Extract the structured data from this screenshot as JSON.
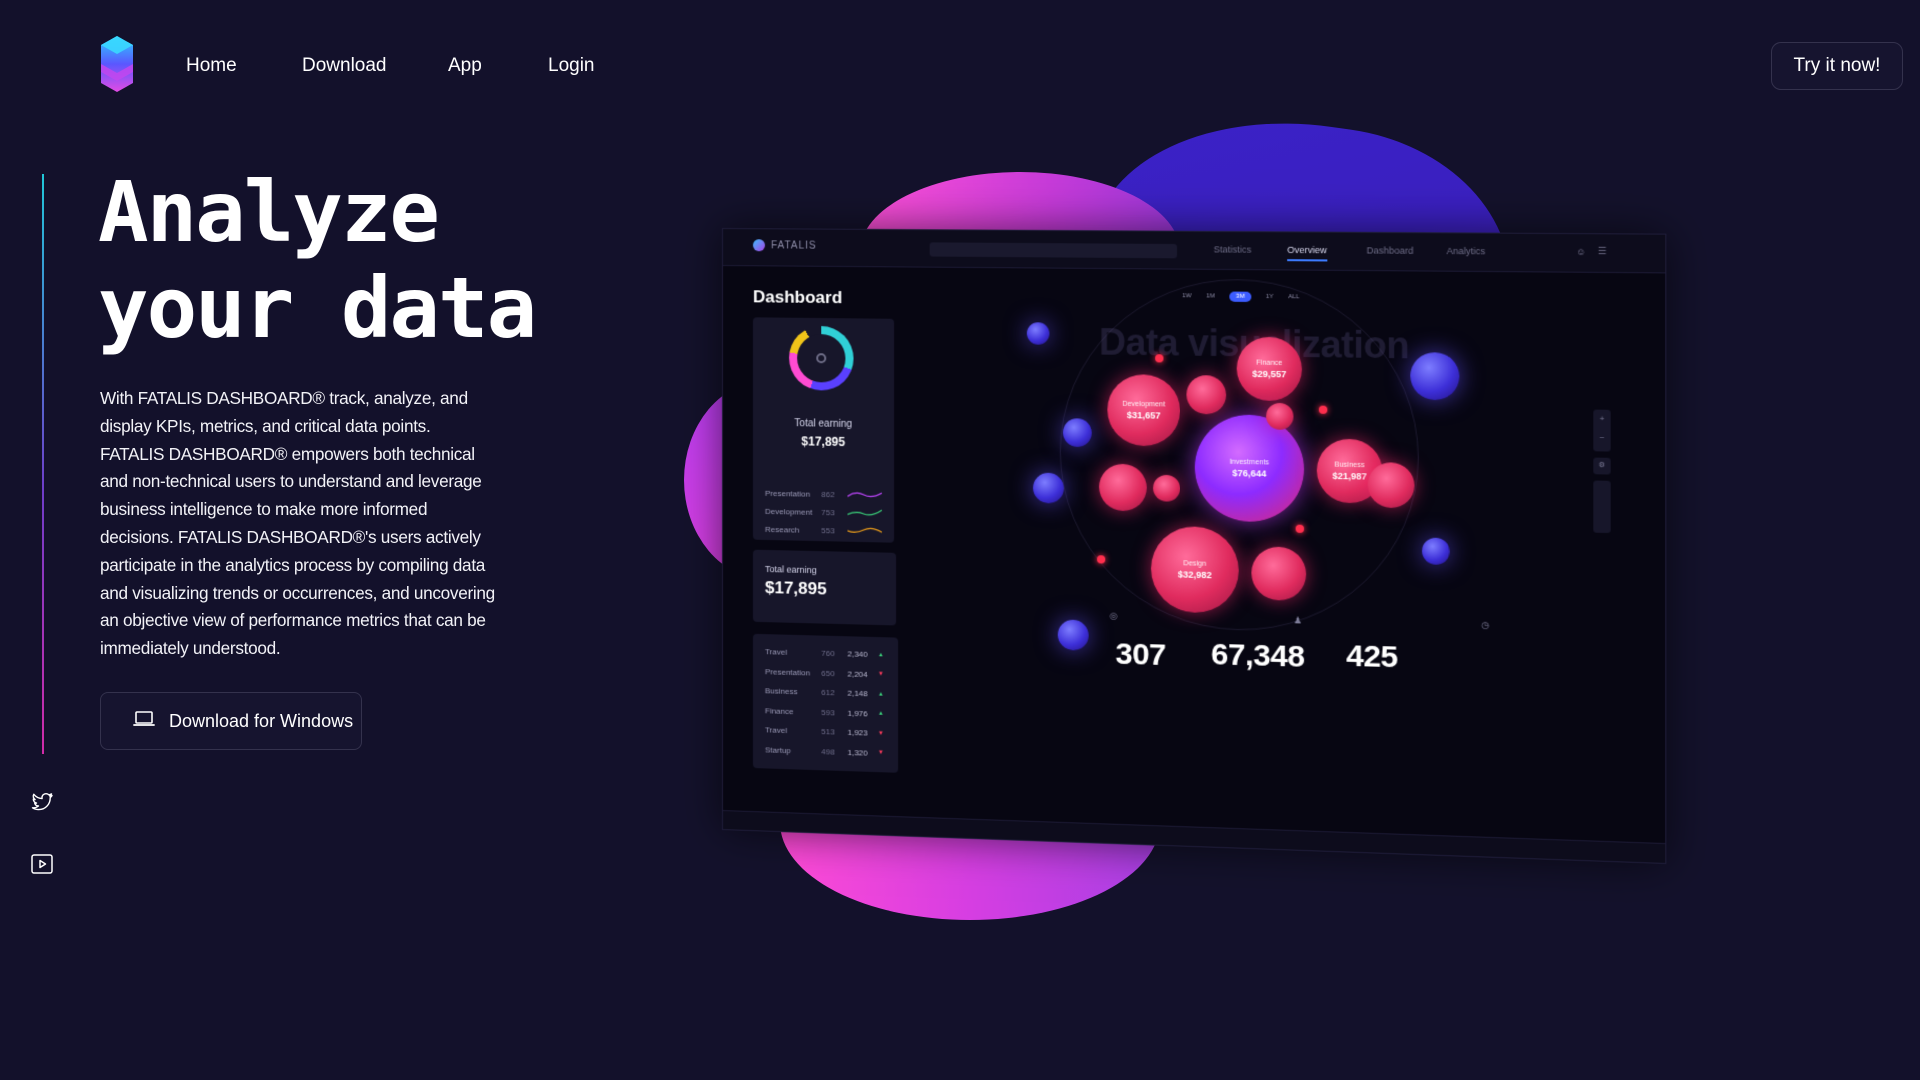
{
  "nav": {
    "home": "Home",
    "download": "Download",
    "app": "App",
    "login": "Login",
    "try_button": "Try it now!"
  },
  "hero": {
    "title_line1": "Analyze",
    "title_line2": "your data",
    "description": "With FATALIS DASHBOARD® track, analyze, and display KPIs, metrics, and critical data points. FATALIS DASHBOARD® empowers both technical and non-technical users to understand and leverage business intelligence to make more informed decisions. FATALIS DASHBOARD®'s users actively participate in the analytics process by compiling data and visualizing trends or occurrences, and uncovering an objective view of performance metrics that can be immediately understood.",
    "download_button": "Download for Windows"
  },
  "icons": {
    "logo": "hexagon-logo-icon",
    "laptop": "laptop-icon",
    "twitter": "twitter-icon",
    "youtube": "play-icon"
  },
  "colors": {
    "background": "#13112b",
    "accent_pink": "#ff4fd8",
    "accent_blue": "#3b22c8",
    "bubble_red": "#e02b5e"
  },
  "dashboard": {
    "brand": "FATALIS",
    "tabs": [
      "Statistics",
      "Overview",
      "Dashboard",
      "Analytics"
    ],
    "heading": "Dashboard",
    "viz_title": "Data visualization",
    "earning_card": {
      "label": "Total earning",
      "value": "$17,895",
      "rows": [
        {
          "label": "Presentation",
          "num": "862"
        },
        {
          "label": "Development",
          "num": "753"
        },
        {
          "label": "Research",
          "num": "553"
        }
      ]
    },
    "earning_card2": {
      "label": "Total earning",
      "value": "$17,895"
    },
    "table": [
      {
        "label": "Travel",
        "a": "760",
        "b": "2,340"
      },
      {
        "label": "Presentation",
        "a": "650",
        "b": "2,204"
      },
      {
        "label": "Business",
        "a": "612",
        "b": "2,148"
      },
      {
        "label": "Finance",
        "a": "593",
        "b": "1,976"
      },
      {
        "label": "Travel",
        "a": "513",
        "b": "1,923"
      },
      {
        "label": "Startup",
        "a": "498",
        "b": "1,320"
      }
    ],
    "ranges": [
      "1W",
      "1M",
      "3M",
      "1Y",
      "ALL"
    ],
    "bubbles": {
      "development": {
        "label": "Development",
        "value": "$31,657"
      },
      "finance": {
        "label": "Finance",
        "value": "$29,557"
      },
      "investments": {
        "label": "Investments",
        "value": "$76,644"
      },
      "business": {
        "label": "Business",
        "value": "$21,987"
      },
      "design": {
        "label": "Design",
        "value": "$32,982"
      }
    },
    "stats": [
      {
        "value": "307"
      },
      {
        "value": "67,348"
      },
      {
        "value": "425"
      }
    ]
  }
}
